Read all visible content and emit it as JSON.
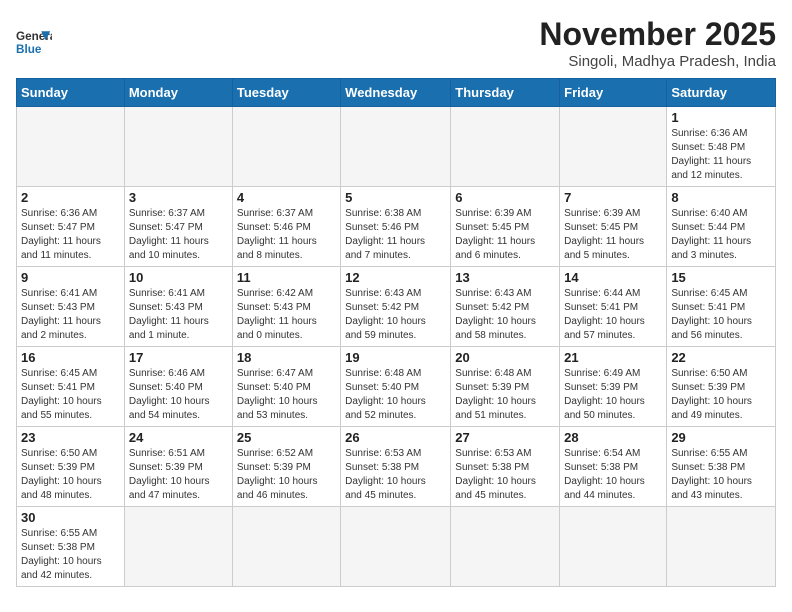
{
  "header": {
    "logo_general": "General",
    "logo_blue": "Blue",
    "month_title": "November 2025",
    "subtitle": "Singoli, Madhya Pradesh, India"
  },
  "weekdays": [
    "Sunday",
    "Monday",
    "Tuesday",
    "Wednesday",
    "Thursday",
    "Friday",
    "Saturday"
  ],
  "weeks": [
    [
      {
        "day": "",
        "info": ""
      },
      {
        "day": "",
        "info": ""
      },
      {
        "day": "",
        "info": ""
      },
      {
        "day": "",
        "info": ""
      },
      {
        "day": "",
        "info": ""
      },
      {
        "day": "",
        "info": ""
      },
      {
        "day": "1",
        "info": "Sunrise: 6:36 AM\nSunset: 5:48 PM\nDaylight: 11 hours\nand 12 minutes."
      }
    ],
    [
      {
        "day": "2",
        "info": "Sunrise: 6:36 AM\nSunset: 5:47 PM\nDaylight: 11 hours\nand 11 minutes."
      },
      {
        "day": "3",
        "info": "Sunrise: 6:37 AM\nSunset: 5:47 PM\nDaylight: 11 hours\nand 10 minutes."
      },
      {
        "day": "4",
        "info": "Sunrise: 6:37 AM\nSunset: 5:46 PM\nDaylight: 11 hours\nand 8 minutes."
      },
      {
        "day": "5",
        "info": "Sunrise: 6:38 AM\nSunset: 5:46 PM\nDaylight: 11 hours\nand 7 minutes."
      },
      {
        "day": "6",
        "info": "Sunrise: 6:39 AM\nSunset: 5:45 PM\nDaylight: 11 hours\nand 6 minutes."
      },
      {
        "day": "7",
        "info": "Sunrise: 6:39 AM\nSunset: 5:45 PM\nDaylight: 11 hours\nand 5 minutes."
      },
      {
        "day": "8",
        "info": "Sunrise: 6:40 AM\nSunset: 5:44 PM\nDaylight: 11 hours\nand 3 minutes."
      }
    ],
    [
      {
        "day": "9",
        "info": "Sunrise: 6:41 AM\nSunset: 5:43 PM\nDaylight: 11 hours\nand 2 minutes."
      },
      {
        "day": "10",
        "info": "Sunrise: 6:41 AM\nSunset: 5:43 PM\nDaylight: 11 hours\nand 1 minute."
      },
      {
        "day": "11",
        "info": "Sunrise: 6:42 AM\nSunset: 5:43 PM\nDaylight: 11 hours\nand 0 minutes."
      },
      {
        "day": "12",
        "info": "Sunrise: 6:43 AM\nSunset: 5:42 PM\nDaylight: 10 hours\nand 59 minutes."
      },
      {
        "day": "13",
        "info": "Sunrise: 6:43 AM\nSunset: 5:42 PM\nDaylight: 10 hours\nand 58 minutes."
      },
      {
        "day": "14",
        "info": "Sunrise: 6:44 AM\nSunset: 5:41 PM\nDaylight: 10 hours\nand 57 minutes."
      },
      {
        "day": "15",
        "info": "Sunrise: 6:45 AM\nSunset: 5:41 PM\nDaylight: 10 hours\nand 56 minutes."
      }
    ],
    [
      {
        "day": "16",
        "info": "Sunrise: 6:45 AM\nSunset: 5:41 PM\nDaylight: 10 hours\nand 55 minutes."
      },
      {
        "day": "17",
        "info": "Sunrise: 6:46 AM\nSunset: 5:40 PM\nDaylight: 10 hours\nand 54 minutes."
      },
      {
        "day": "18",
        "info": "Sunrise: 6:47 AM\nSunset: 5:40 PM\nDaylight: 10 hours\nand 53 minutes."
      },
      {
        "day": "19",
        "info": "Sunrise: 6:48 AM\nSunset: 5:40 PM\nDaylight: 10 hours\nand 52 minutes."
      },
      {
        "day": "20",
        "info": "Sunrise: 6:48 AM\nSunset: 5:39 PM\nDaylight: 10 hours\nand 51 minutes."
      },
      {
        "day": "21",
        "info": "Sunrise: 6:49 AM\nSunset: 5:39 PM\nDaylight: 10 hours\nand 50 minutes."
      },
      {
        "day": "22",
        "info": "Sunrise: 6:50 AM\nSunset: 5:39 PM\nDaylight: 10 hours\nand 49 minutes."
      }
    ],
    [
      {
        "day": "23",
        "info": "Sunrise: 6:50 AM\nSunset: 5:39 PM\nDaylight: 10 hours\nand 48 minutes."
      },
      {
        "day": "24",
        "info": "Sunrise: 6:51 AM\nSunset: 5:39 PM\nDaylight: 10 hours\nand 47 minutes."
      },
      {
        "day": "25",
        "info": "Sunrise: 6:52 AM\nSunset: 5:39 PM\nDaylight: 10 hours\nand 46 minutes."
      },
      {
        "day": "26",
        "info": "Sunrise: 6:53 AM\nSunset: 5:38 PM\nDaylight: 10 hours\nand 45 minutes."
      },
      {
        "day": "27",
        "info": "Sunrise: 6:53 AM\nSunset: 5:38 PM\nDaylight: 10 hours\nand 45 minutes."
      },
      {
        "day": "28",
        "info": "Sunrise: 6:54 AM\nSunset: 5:38 PM\nDaylight: 10 hours\nand 44 minutes."
      },
      {
        "day": "29",
        "info": "Sunrise: 6:55 AM\nSunset: 5:38 PM\nDaylight: 10 hours\nand 43 minutes."
      }
    ],
    [
      {
        "day": "30",
        "info": "Sunrise: 6:55 AM\nSunset: 5:38 PM\nDaylight: 10 hours\nand 42 minutes."
      },
      {
        "day": "",
        "info": ""
      },
      {
        "day": "",
        "info": ""
      },
      {
        "day": "",
        "info": ""
      },
      {
        "day": "",
        "info": ""
      },
      {
        "day": "",
        "info": ""
      },
      {
        "day": "",
        "info": ""
      }
    ]
  ]
}
